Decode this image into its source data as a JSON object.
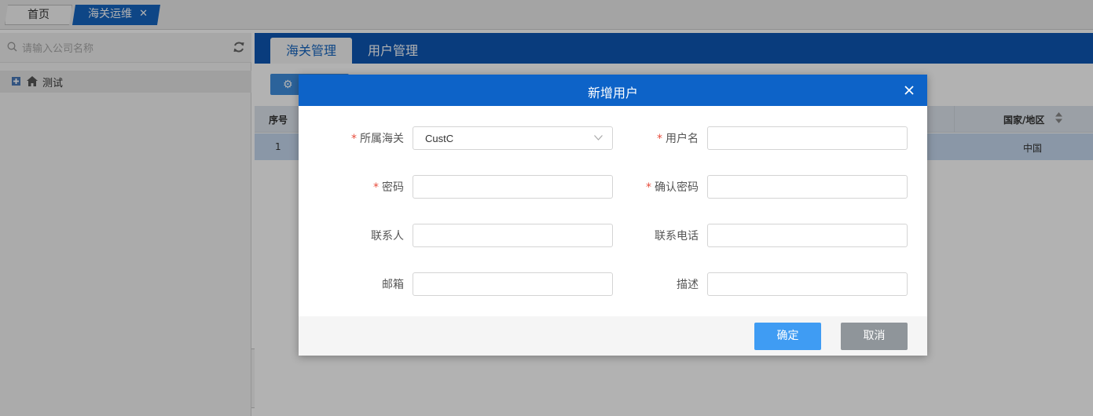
{
  "top_tabs": {
    "home": "首页",
    "active": "海关运维"
  },
  "left_panel": {
    "search_placeholder": "请输入公司名称",
    "tree_item": "测试"
  },
  "sub_tabs": {
    "active": "海关管理",
    "other": "用户管理"
  },
  "table": {
    "headers": {
      "seq": "序号",
      "country": "国家/地区"
    },
    "rows": [
      {
        "seq": "1",
        "country": "中国"
      }
    ]
  },
  "modal": {
    "title": "新增用户",
    "fields": {
      "customs": {
        "label": "所属海关",
        "value": "CustC",
        "required": true
      },
      "username": {
        "label": "用户名",
        "value": "",
        "required": true
      },
      "password": {
        "label": "密码",
        "value": "",
        "required": true
      },
      "confirm_password": {
        "label": "确认密码",
        "value": "",
        "required": true
      },
      "contact": {
        "label": "联系人",
        "value": "",
        "required": false
      },
      "phone": {
        "label": "联系电话",
        "value": "",
        "required": false
      },
      "email": {
        "label": "邮箱",
        "value": "",
        "required": false
      },
      "description": {
        "label": "描述",
        "value": "",
        "required": false
      }
    },
    "required_mark": "*",
    "confirm_label": "确定",
    "cancel_label": "取消"
  },
  "colors": {
    "primary": "#0d63c8",
    "tab_bar": "#0d56b3",
    "confirm": "#3f9cf3",
    "cancel": "#8f959a",
    "required": "#e74c3c"
  }
}
